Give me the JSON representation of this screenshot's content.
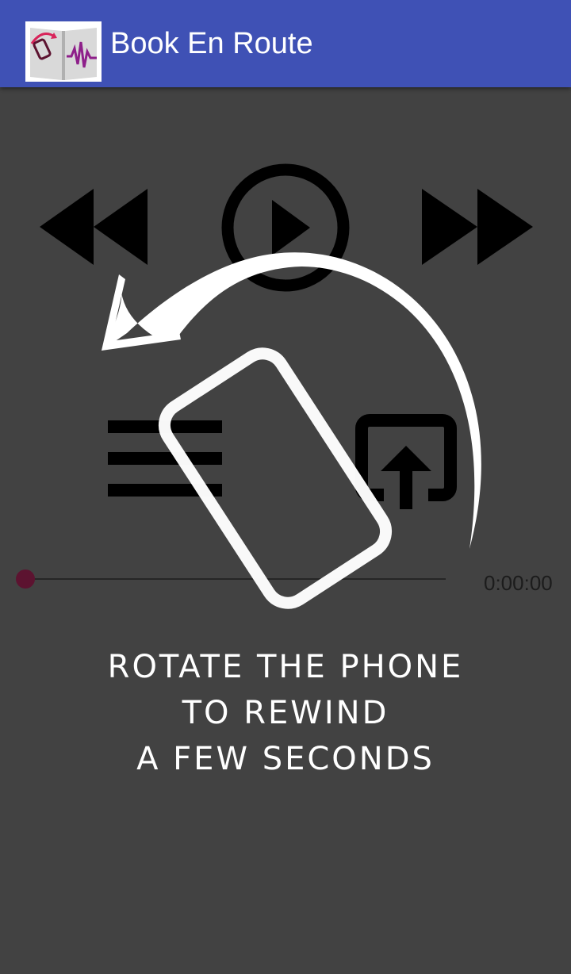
{
  "app_bar": {
    "title": "Book En Route",
    "icon": "book-waveform-logo",
    "color": "#3f51b5"
  },
  "player": {
    "background": "#424242",
    "controls": [
      "rewind-icon",
      "play-circle-icon",
      "fast-forward-icon",
      "menu-icon",
      "share-icon"
    ],
    "seek": {
      "position_fraction": 0,
      "time": "0:00:00",
      "thumb_color": "#5c1330"
    }
  },
  "tutorial": {
    "icons": [
      "curved-arrow-icon",
      "phone-outline-icon"
    ],
    "lines": [
      "ROTATE THE PHONE",
      "TO REWIND",
      "A FEW SECONDS"
    ]
  }
}
